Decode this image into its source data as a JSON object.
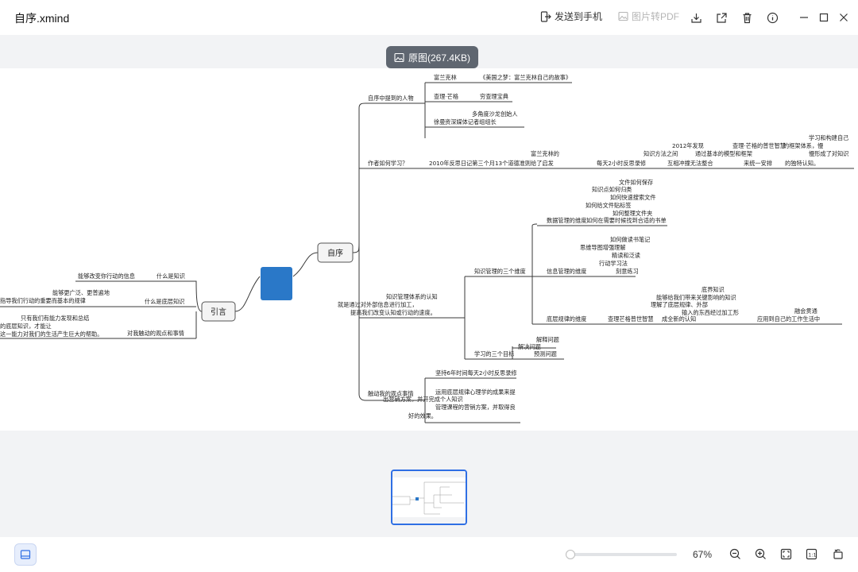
{
  "window": {
    "title": "自序.xmind",
    "send_to_phone": "发送到手机",
    "image_to_pdf": "图片转PDF"
  },
  "preview": {
    "original_label": "原图(267.4KB)"
  },
  "mindmap": {
    "center": "自序",
    "left_branch": "引言",
    "left": [
      {
        "label": "什么是知识",
        "leaf": "能够改变你行动的信息"
      },
      {
        "label": "什么是底层知识",
        "leaf": [
          "能够更广泛、更普遍地",
          "指导我们行动的重要而基本的规律"
        ]
      },
      {
        "label": "对我触动的观点和事情",
        "leaf": [
          "只有我们有能力发现和总结",
          "的底层知识，才能让",
          "这一能力对我们的生活产生巨大的帮助。"
        ]
      }
    ],
    "right": {
      "people": {
        "label": "自序中提到的人物",
        "items": [
          {
            "a": "富兰克林",
            "b": "《美国之梦：富兰克林自己的故事》"
          },
          {
            "a": "查理·芒格",
            "b": "穷查理宝典"
          },
          {
            "a": "徐曼",
            "b": [
              "多角度沙龙创始人",
              "资深媒体记者组组长"
            ]
          }
        ]
      },
      "how_learn": {
        "label": "作者如何学习？",
        "line1": "2010年反思日记第三个月13个道德准则给了启发",
        "franklin_note": "富兰克林的",
        "reflect": "每天2小时反思录修",
        "method": "知识方法之间",
        "year2012": "2012年发现",
        "mutual": "互相冲撞无法整合",
        "model": "通过基本的模型和框架",
        "unify": "来统一安排",
        "munger": "查理·芒格的普世智慧",
        "build": "学习和构建自己",
        "framework": "的框架体系，慢",
        "formed": "慢形成了对知识",
        "unique": "的独特认知。"
      },
      "system": {
        "label": "知识管理体系的认知",
        "definition": [
          "就是通过对外部信息进行加工，",
          "提高我们改变认知或行动的速度。"
        ],
        "three_dim": "知识管理的三个维度",
        "data_dim": "数据管理的维度",
        "data_items": [
          "文件如何保存",
          "知识点如何归类",
          "如何快速搜索文件",
          "如何给文件贴标签",
          "如何整理文件夹",
          "如何在需要时候找到合适的书单"
        ],
        "info_dim": "信息管理的维度",
        "info_items": [
          "如何做读书笔记",
          "思维导图增强理解",
          "精读和泛读",
          "行动学习法",
          "刻意练习"
        ],
        "law_dim": "底层规律的维度",
        "law_items": [
          "查理芒格普世智慧",
          "底界知识",
          "能够给我们带来关键影响的知识",
          "理解了底层规律、外部",
          "输入的东西经过加工形",
          "成全新的认知",
          "融会贯通",
          "应用到自己的工作生活中"
        ],
        "three_goals": "学习的三个目标",
        "goals": [
          "解释问题",
          "解决问题",
          "预测问题"
        ]
      },
      "touch": {
        "label": "触动我的观点事情",
        "items": [
          "坚持6年时间每天2小时反思录修",
          "运用底层规律心理学的成果来提",
          "出营销方案，并开完成个人知识",
          "管理课程的营销方案，并取得良",
          "好的效果。"
        ]
      }
    }
  },
  "zoom": {
    "level_label": "67%",
    "level": 0.04
  }
}
